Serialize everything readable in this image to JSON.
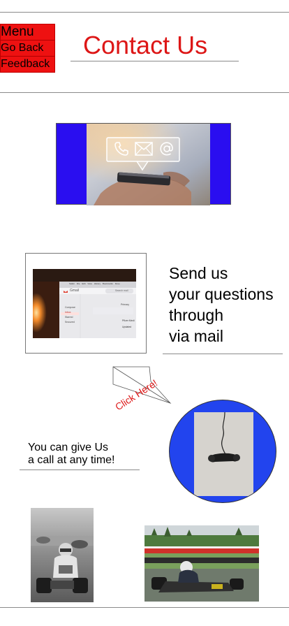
{
  "header": {
    "menu_label": "Menu",
    "go_back_label": "Go Back",
    "feedback_label": "Feedback",
    "title": "Contact Us"
  },
  "colors": {
    "accent_red": "#dd1616",
    "menu_bg": "#ee1111",
    "brand_blue": "#2a0ef0",
    "circle_blue": "#2244ee"
  },
  "hero": {
    "icons": [
      "phone-icon",
      "envelope-icon",
      "at-sign-icon"
    ]
  },
  "mail_section": {
    "lines": [
      "Send us",
      "your questions",
      "through",
      "via mail"
    ],
    "screenshot": {
      "app_name": "Gmail",
      "menu_items": [
        "Safari",
        "File",
        "Edit",
        "View",
        "History",
        "Bookmarks",
        "Deve"
      ],
      "search_placeholder": "Search mail",
      "sidebar_items": [
        "Compose",
        "Inbox",
        "Starred",
        "Snoozed"
      ],
      "tabs": [
        "Primary"
      ],
      "list_labels": [
        "Pfizer Medi",
        "Updated"
      ]
    }
  },
  "click_here": {
    "label": "Click Here!"
  },
  "call_section": {
    "lines": [
      "You can give Us",
      "a call at any time!"
    ]
  }
}
